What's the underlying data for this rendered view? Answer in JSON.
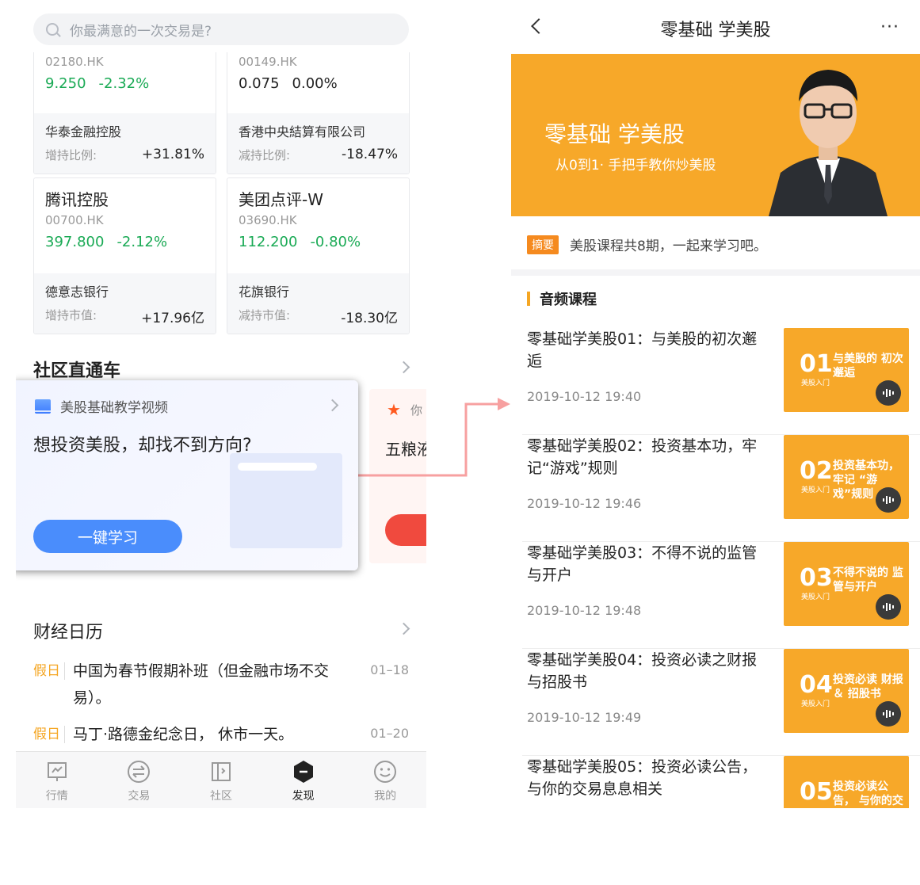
{
  "left": {
    "search_placeholder": "你最满意的一次交易是?",
    "cards": [
      {
        "name": "",
        "code": "02180.HK",
        "price": "9.250",
        "change": "-2.32%",
        "holder": "华泰金融控股",
        "hold_label": "增持比例:",
        "hold_value": "+31.81%"
      },
      {
        "name": "",
        "code": "00149.HK",
        "price": "0.075",
        "change": "0.00%",
        "holder": "香港中央結算有限公司",
        "hold_label": "减持比例:",
        "hold_value": "-18.47%"
      },
      {
        "name": "腾讯控股",
        "code": "00700.HK",
        "price": "397.800",
        "change": "-2.12%",
        "holder": "德意志银行",
        "hold_label": "增持市值:",
        "hold_value": "+17.96亿"
      },
      {
        "name": "美团点评-W",
        "code": "03690.HK",
        "price": "112.200",
        "change": "-0.80%",
        "holder": "花旗银行",
        "hold_label": "减持市值:",
        "hold_value": "-18.30亿"
      }
    ],
    "community_title": "社区直通车",
    "popup": {
      "header": "美股基础教学视频",
      "question": "想投资美股，却找不到方向?",
      "button": "一键学习"
    },
    "next_card": {
      "label": "你",
      "title": "五粮液"
    },
    "calendar_title": "财经日历",
    "calendar": [
      {
        "tag": "假日",
        "text": "中国为春节假期补班（但金融市场不交易）。",
        "date": "01–18"
      },
      {
        "tag": "假日",
        "text": "马丁·路德金纪念日， 休市一天。",
        "date": "01–20"
      }
    ],
    "tabs": [
      {
        "label": "行情",
        "icon": "market-icon"
      },
      {
        "label": "交易",
        "icon": "trade-icon"
      },
      {
        "label": "社区",
        "icon": "community-icon"
      },
      {
        "label": "发现",
        "icon": "discover-icon"
      },
      {
        "label": "我的",
        "icon": "profile-icon"
      }
    ]
  },
  "right": {
    "nav_title": "零基础 学美股",
    "more": "···",
    "banner_title": "零基础 学美股",
    "banner_sub": "从0到1· 手把手教你炒美股",
    "summary_tag": "摘要",
    "summary_text": "美股课程共8期，一起来学习吧。",
    "audio_title": "音频课程",
    "courses": [
      {
        "title": "零基础学美股01：与美股的初次邂逅",
        "date": "2019-10-12 19:40",
        "num": "01",
        "thumb_text": "与美股的 初次邂逅",
        "thumb_sub": "美股入门"
      },
      {
        "title": "零基础学美股02：投资基本功，牢记“游戏”规则",
        "date": "2019-10-12 19:46",
        "num": "02",
        "thumb_text": "投资基本功，牢记 “游戏”规则",
        "thumb_sub": "美股入门"
      },
      {
        "title": "零基础学美股03：不得不说的监管与开户",
        "date": "2019-10-12 19:48",
        "num": "03",
        "thumb_text": "不得不说的 监管与开户",
        "thumb_sub": "美股入门"
      },
      {
        "title": "零基础学美股04：投资必读之财报与招股书",
        "date": "2019-10-12 19:49",
        "num": "04",
        "thumb_text": "投资必读 财报＆ 招股书",
        "thumb_sub": "美股入门"
      },
      {
        "title": "零基础学美股05：投资必读公告，与你的交易息息相关",
        "date": "",
        "num": "05",
        "thumb_text": "投资必读公告， 与你的交易",
        "thumb_sub": ""
      }
    ]
  },
  "colors": {
    "accent_orange": "#f7a829",
    "green": "#1aaa55",
    "blue": "#4a8dfc"
  }
}
